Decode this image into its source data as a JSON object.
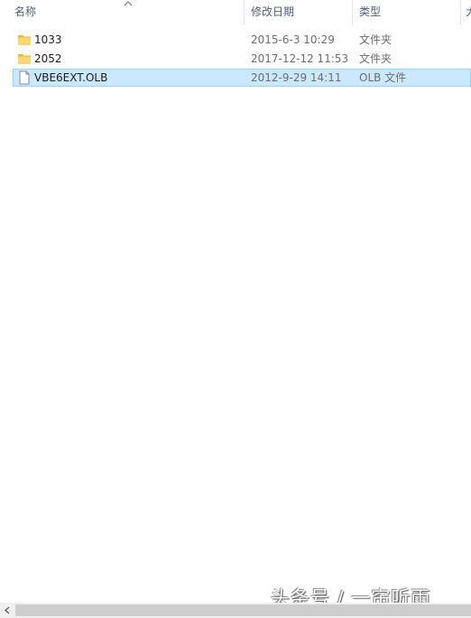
{
  "columns": {
    "name": "名称",
    "date": "修改日期",
    "type": "类型",
    "size": "大"
  },
  "rows": [
    {
      "name": "1033",
      "date": "2015-6-3 10:29",
      "type": "文件夹",
      "icon": "folder-icon"
    },
    {
      "name": "2052",
      "date": "2017-12-12 11:53",
      "type": "文件夹",
      "icon": "folder-icon"
    },
    {
      "name": "VBE6EXT.OLB",
      "date": "2012-9-29 14:11",
      "type": "OLB 文件",
      "icon": "file-icon",
      "selected": true
    }
  ],
  "watermark": "头条号 / 一帘听雨",
  "colors": {
    "selection_bg": "#cce8ff",
    "selection_border": "#99d1ff",
    "header_text": "#4c607a",
    "folder": "#f8d775"
  }
}
